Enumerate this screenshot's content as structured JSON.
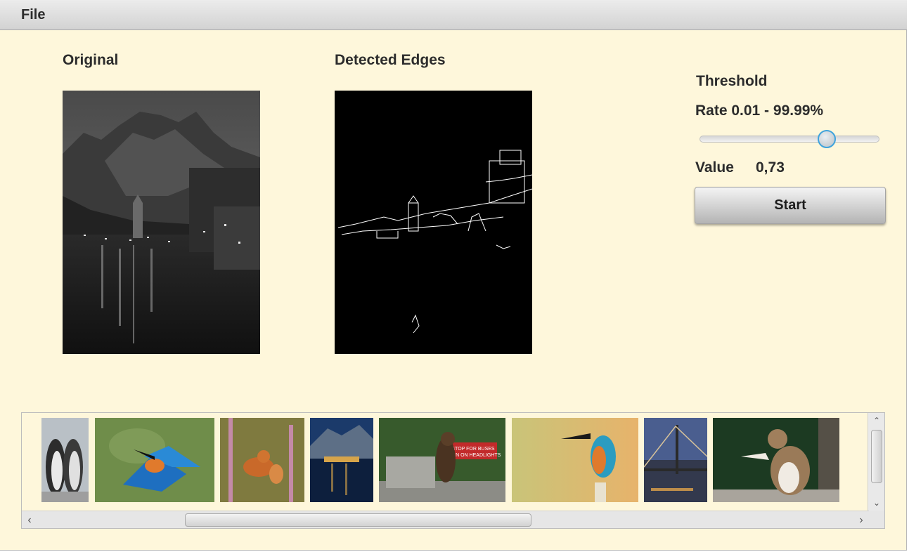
{
  "menubar": {
    "file_label": "File"
  },
  "panels": {
    "original_label": "Original",
    "edges_label": "Detected Edges"
  },
  "threshold": {
    "title": "Threshold",
    "rate_label": "Rate 0.01 - 99.99%",
    "value_label": "Value",
    "value": "0,73",
    "slider_fraction": 0.73,
    "start_label": "Start"
  },
  "gallery": {
    "thumbnails": [
      {
        "name": "penguins"
      },
      {
        "name": "kingfisher-in-flight"
      },
      {
        "name": "squirrel-in-flowers"
      },
      {
        "name": "lakeside-village-night"
      },
      {
        "name": "bear-at-sign"
      },
      {
        "name": "kingfisher-perched"
      },
      {
        "name": "bridge-at-dusk"
      },
      {
        "name": "squirrel-eating"
      }
    ],
    "sign_text_1": "STOP FOR BUSES",
    "sign_text_2": "TURN ON HEADLIGHTS",
    "h_scroll_position": 0.38,
    "v_scroll_position": 0.0
  },
  "colors": {
    "background": "#fef7db",
    "slider_accent": "#3fa3dc"
  }
}
